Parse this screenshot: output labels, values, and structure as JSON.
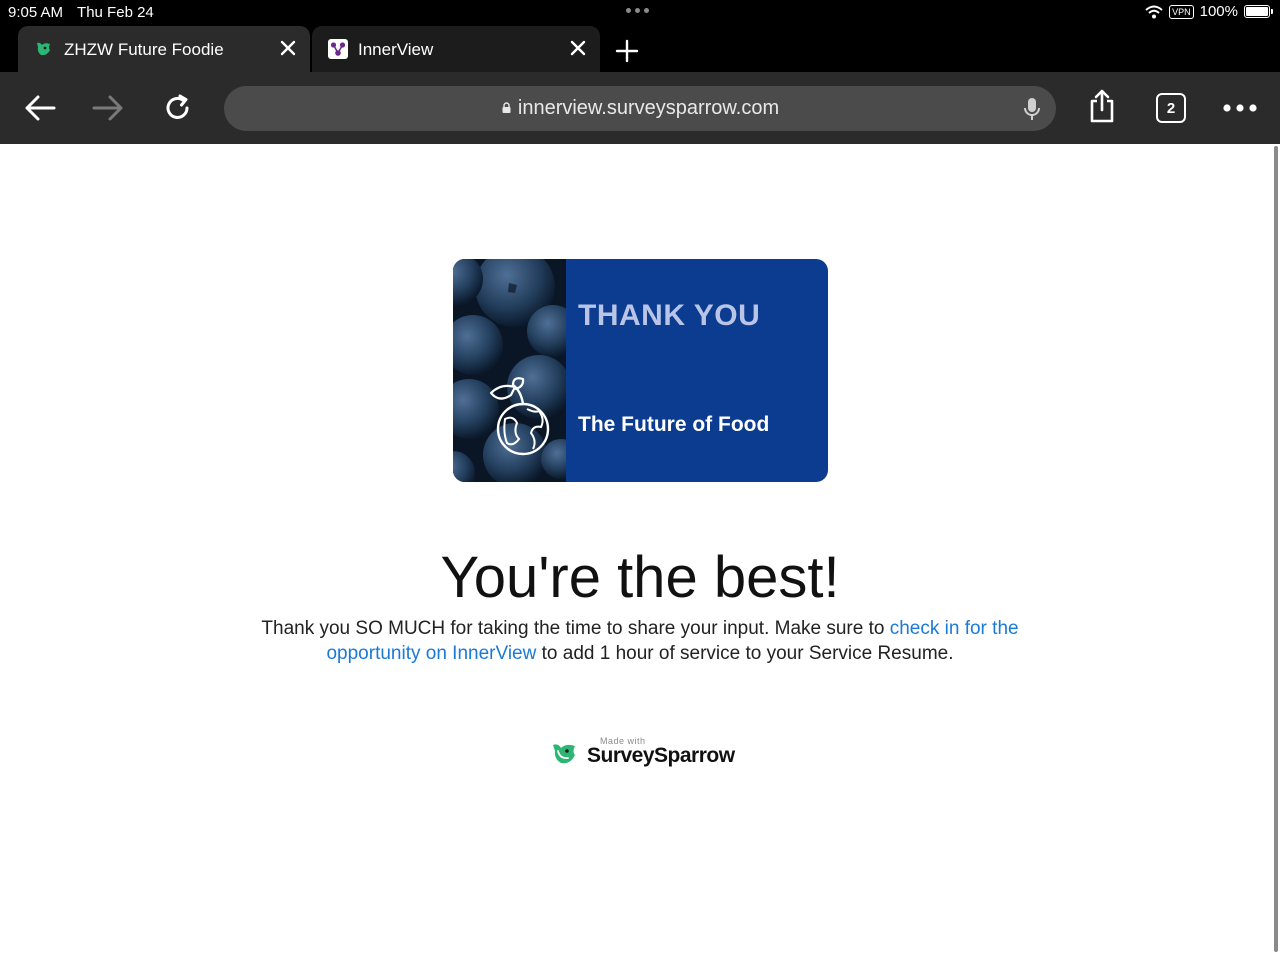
{
  "status_bar": {
    "time": "9:05 AM",
    "date": "Thu Feb 24",
    "vpn": "VPN",
    "battery": "100%"
  },
  "tabs": [
    {
      "title": "ZHZW Future Foodie",
      "favicon": "surveysparrow-bird-icon",
      "active": true
    },
    {
      "title": "InnerView",
      "favicon": "innerview-icon",
      "active": false
    }
  ],
  "toolbar": {
    "url": "innerview.surveysparrow.com",
    "tab_count": "2"
  },
  "card": {
    "heading": "THANK YOU",
    "subheading": "The Future of Food",
    "icon": "globe-sprout-icon"
  },
  "content": {
    "headline": "You're the best!",
    "text_before": "Thank you SO MUCH for taking the time to share your input. Make sure to ",
    "link_text": "check in for the opportunity on InnerView",
    "text_after": " to add 1 hour of service to your Service Resume."
  },
  "footer": {
    "made_with": "Made with",
    "brand": "SurveySparrow"
  },
  "colors": {
    "card_blue": "#0b3c8f",
    "link": "#1a7ad6",
    "brand_green": "#2bb673",
    "innerview_purple": "#6b2a8f"
  }
}
